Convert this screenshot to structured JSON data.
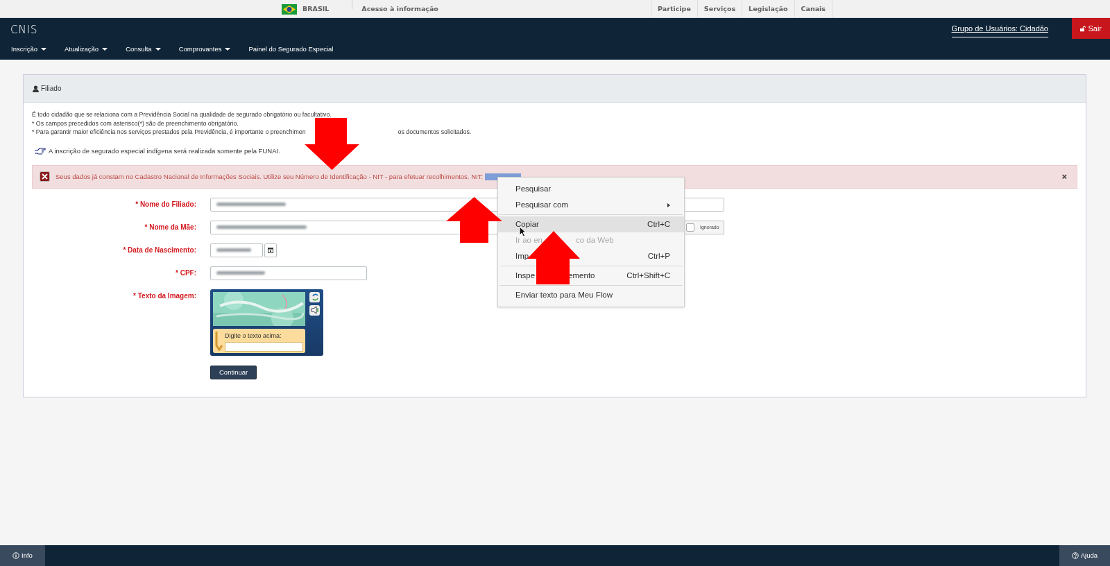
{
  "gov_bar": {
    "country": "BRASIL",
    "access_link": "Acesso à informação",
    "links": [
      "Participe",
      "Serviços",
      "Legislação",
      "Canais"
    ]
  },
  "header": {
    "logo": "CNIS",
    "user_group": "Grupo de Usuários: Cidadão",
    "logout": "Sair"
  },
  "menu": [
    {
      "label": "Inscrição",
      "dropdown": true
    },
    {
      "label": "Atualização",
      "dropdown": true
    },
    {
      "label": "Consulta",
      "dropdown": true
    },
    {
      "label": "Comprovantes",
      "dropdown": true
    },
    {
      "label": "Painel do Segurado Especial",
      "dropdown": false
    }
  ],
  "panel": {
    "title": "Filiado",
    "intro": [
      {
        "text": "É todo cidadão que se relaciona com a Previdência Social na qualidade de segurado obrigatório ou facultativo."
      },
      {
        "text": "* Os campos precedidos com asterisco(*) são de preenchimento obrigatório."
      },
      {
        "text": "* Para garantir maior eficiência nos serviços prestados pela Previdência, é importante o preenchimen",
        "text_after": "os documentos solicitados."
      }
    ],
    "notice": "A inscrição de segurado especial indígena será realizada somente pela FUNAI.",
    "alert": {
      "text": "Seus dados já constam no Cadastro Nacional de Informações Sociais. Utilize seu Número de Identificação - NIT - para efetuar recolhimentos. NIT:",
      "close": "×"
    },
    "fields": [
      {
        "label": "* Nome do Filiado:",
        "kind": "long"
      },
      {
        "label": "* Nome da Mãe:",
        "kind": "ignorable",
        "ignored_label": "Ignorado",
        "checked": false
      },
      {
        "label": "* Data de Nascimento:",
        "kind": "date"
      },
      {
        "label": "* CPF:",
        "kind": "medium"
      },
      {
        "label": "* Texto da Imagem:",
        "kind": "captcha",
        "prompt": "Digite o texto acima:"
      }
    ],
    "submit": "Continuar"
  },
  "context_menu": [
    {
      "kind": "item",
      "label": "Pesquisar",
      "selected": false,
      "disabled": false
    },
    {
      "kind": "item",
      "label": "Pesquisar com",
      "submenu": true,
      "selected": false,
      "disabled": false
    },
    {
      "kind": "separator"
    },
    {
      "kind": "item",
      "label": "Copiar",
      "shortcut": "Ctrl+C",
      "selected": true,
      "disabled": false
    },
    {
      "kind": "item",
      "label": "Ir ao en",
      "label_after": "co da Web",
      "selected": false,
      "disabled": true
    },
    {
      "kind": "item",
      "label": "Imp",
      "shortcut": "Ctrl+P",
      "selected": false,
      "disabled": false
    },
    {
      "kind": "separator"
    },
    {
      "kind": "item",
      "label": "Inspe",
      "label_after": "emento",
      "shortcut": "Ctrl+Shift+C",
      "selected": false,
      "disabled": false
    },
    {
      "kind": "separator"
    },
    {
      "kind": "item",
      "label": "Enviar texto para Meu Flow",
      "selected": false,
      "disabled": false
    }
  ],
  "footer": {
    "info": "Info",
    "help": "Ajuda"
  }
}
